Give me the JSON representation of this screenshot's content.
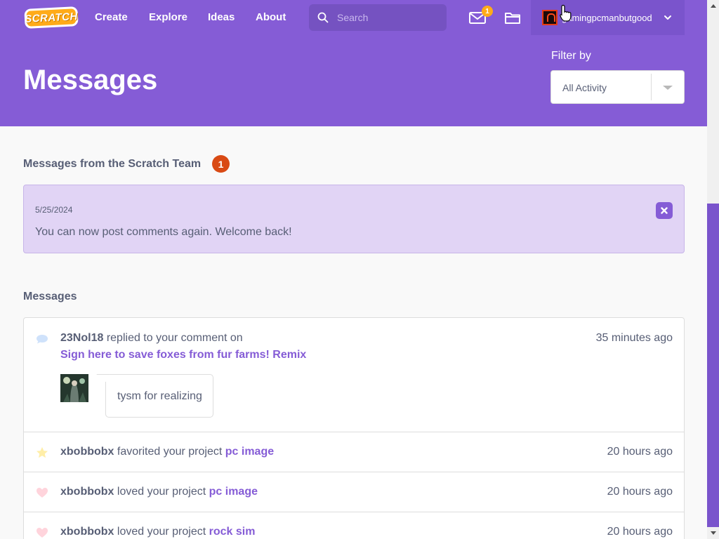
{
  "nav": {
    "logo_text": "SCRATCH",
    "links": [
      "Create",
      "Explore",
      "Ideas",
      "About"
    ],
    "search_placeholder": "Search",
    "message_count": "1",
    "username": "gamingpcmanbutgood"
  },
  "header": {
    "title": "Messages",
    "filter_label": "Filter by",
    "filter_value": "All Activity"
  },
  "team_section": {
    "title": "Messages from the Scratch Team",
    "badge": "1",
    "alert": {
      "date": "5/25/2024",
      "text": "You can now post comments again. Welcome back!"
    }
  },
  "messages_section": {
    "title": "Messages",
    "items": [
      {
        "type": "comment",
        "icon": "comment-icon",
        "user": "23Nol18",
        "action": "replied to your comment on",
        "target": "Sign here to save foxes from fur farms! Remix",
        "time": "35 minutes ago",
        "reply": "tysm for realizing"
      },
      {
        "type": "favorite",
        "icon": "star-icon",
        "user": "xbobbobx",
        "action": "favorited your project",
        "target": "pc image",
        "time": "20 hours ago"
      },
      {
        "type": "love",
        "icon": "heart-icon",
        "user": "xbobbobx",
        "action": "loved your project",
        "target": "pc image",
        "time": "20 hours ago"
      },
      {
        "type": "love",
        "icon": "heart-icon",
        "user": "xbobbobx",
        "action": "loved your project",
        "target": "rock sim",
        "time": "20 hours ago"
      }
    ]
  },
  "colors": {
    "brand": "#855cd6",
    "brand_dark": "#7552c1",
    "badge_orange": "#ffab19",
    "badge_red": "#d94a14",
    "alert_bg": "#e1d4f5"
  }
}
